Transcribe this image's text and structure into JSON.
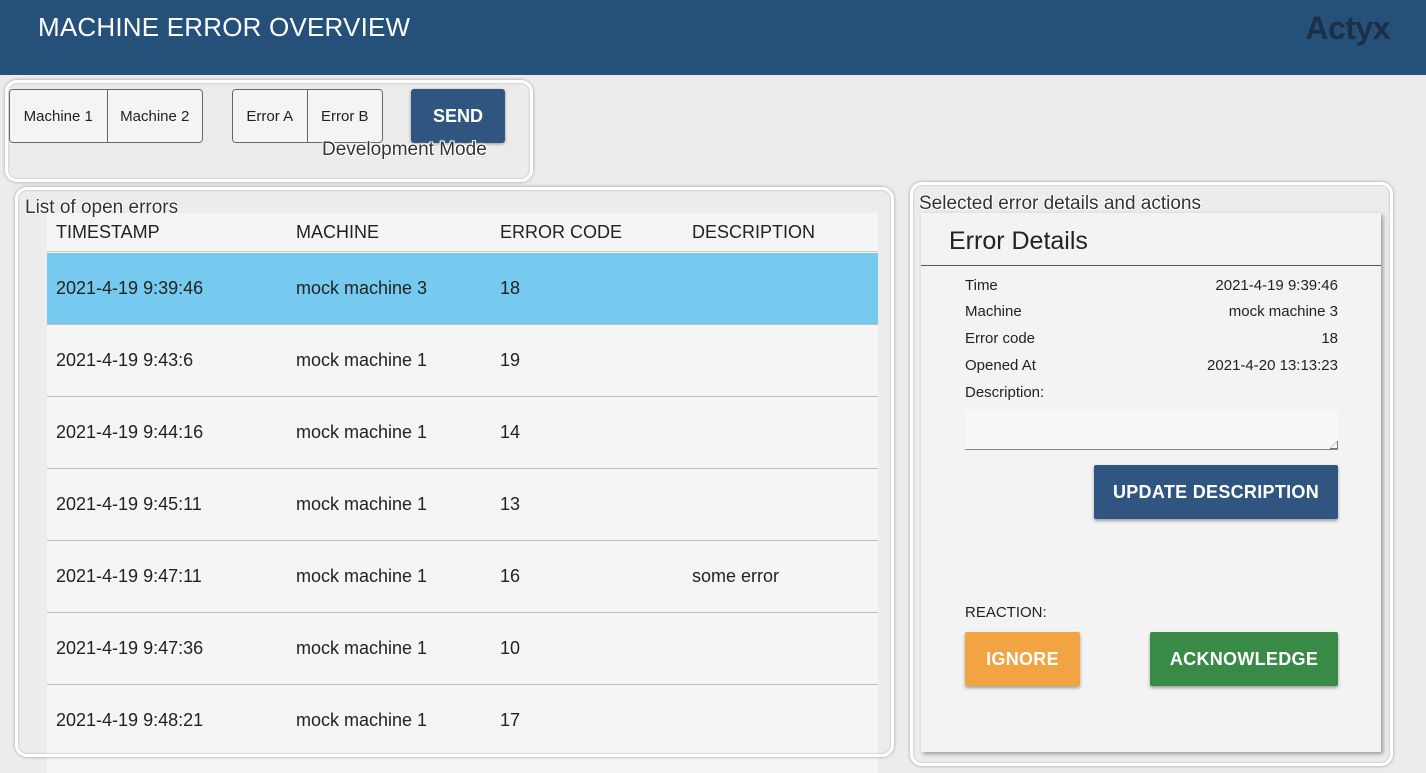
{
  "header": {
    "title": "MACHINE ERROR OVERVIEW",
    "brand": "Actyx",
    "header_color": "#24507a"
  },
  "dev_panel": {
    "annotation": "Development Mode",
    "machines": [
      "Machine 1",
      "Machine 2"
    ],
    "errors": [
      "Error A",
      "Error B"
    ],
    "send_label": "SEND"
  },
  "error_list": {
    "annotation": "List of open errors",
    "columns": [
      "TIMESTAMP",
      "MACHINE",
      "ERROR CODE",
      "DESCRIPTION"
    ],
    "selected_index": 0,
    "selected_color": "#76c9ef",
    "rows": [
      {
        "timestamp": "2021-4-19 9:39:46",
        "machine": "mock machine 3",
        "code": "18",
        "description": ""
      },
      {
        "timestamp": "2021-4-19 9:43:6",
        "machine": "mock machine 1",
        "code": "19",
        "description": ""
      },
      {
        "timestamp": "2021-4-19 9:44:16",
        "machine": "mock machine 1",
        "code": "14",
        "description": ""
      },
      {
        "timestamp": "2021-4-19 9:45:11",
        "machine": "mock machine 1",
        "code": "13",
        "description": ""
      },
      {
        "timestamp": "2021-4-19 9:47:11",
        "machine": "mock machine 1",
        "code": "16",
        "description": "some error"
      },
      {
        "timestamp": "2021-4-19 9:47:36",
        "machine": "mock machine 1",
        "code": "10",
        "description": ""
      },
      {
        "timestamp": "2021-4-19 9:48:21",
        "machine": "mock machine 1",
        "code": "17",
        "description": ""
      }
    ]
  },
  "details": {
    "annotation": "Selected error details and actions",
    "title": "Error Details",
    "fields": [
      {
        "label": "Time",
        "value": "2021-4-19 9:39:46"
      },
      {
        "label": "Machine",
        "value": "mock machine 3"
      },
      {
        "label": "Error code",
        "value": "18"
      },
      {
        "label": "Opened At",
        "value": "2021-4-20 13:13:23"
      }
    ],
    "description_label": "Description:",
    "description_value": "",
    "update_label": "UPDATE DESCRIPTION",
    "reaction_label": "REACTION:",
    "ignore_label": "IGNORE",
    "acknowledge_label": "ACKNOWLEDGE",
    "colors": {
      "update": "#2f5580",
      "ignore": "#f3a442",
      "acknowledge": "#3a8a47"
    }
  }
}
